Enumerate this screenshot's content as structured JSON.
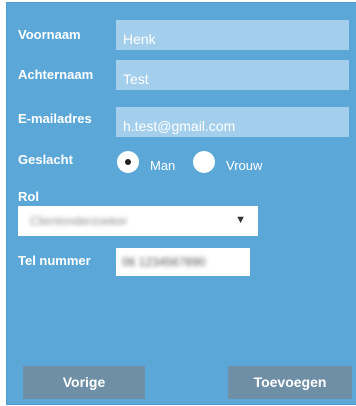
{
  "form": {
    "firstname": {
      "label": "Voornaam",
      "value": "Henk"
    },
    "lastname": {
      "label": "Achternaam",
      "value": "Test"
    },
    "email": {
      "label": "E-mailadres",
      "value": "h.test@gmail.com"
    },
    "gender": {
      "label": "Geslacht",
      "options": [
        "Man",
        "Vrouw"
      ],
      "selected": "Man"
    },
    "role": {
      "label": "Rol",
      "value": "Clientonderzoeker",
      "arrow": "▼"
    },
    "phone": {
      "label": "Tel nummer",
      "value": "06 1234567890"
    }
  },
  "buttons": {
    "prev": "Vorige",
    "add": "Toevoegen"
  },
  "colors": {
    "panel": "#5aa7d8",
    "field": "#a4cfec",
    "button": "#6f8fa6"
  }
}
